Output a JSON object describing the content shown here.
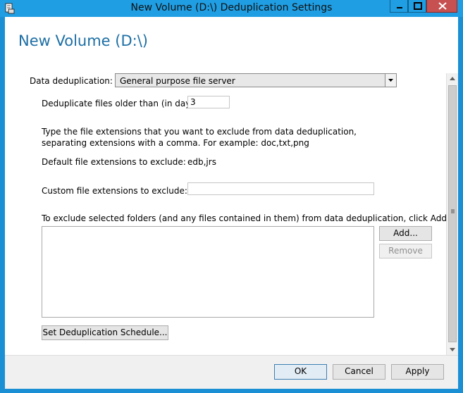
{
  "window": {
    "title": "New Volume (D:\\) Deduplication Settings",
    "icon": "volume-settings-icon",
    "controls": [
      "minimize-icon",
      "maximize-icon",
      "close-icon"
    ]
  },
  "page": {
    "heading": "New Volume (D:\\)"
  },
  "dedup": {
    "mode_label": "Data deduplication:",
    "mode_value": "General purpose file server",
    "age_label": "Deduplicate files older than (in days):",
    "age_value": "3",
    "instructions": "Type the file extensions that you want to exclude from data deduplication, separating extensions with a comma. For example: doc,txt,png",
    "default_ext_label": "Default file extensions to exclude:",
    "default_ext_value": "edb,jrs",
    "custom_ext_label": "Custom file extensions to exclude:",
    "custom_ext_value": "",
    "folders_instruction": "To exclude selected folders (and any files contained in them) from data deduplication, click Add.",
    "add_label": "Add...",
    "remove_label": "Remove",
    "schedule_label": "Set Deduplication Schedule..."
  },
  "footer": {
    "ok_label": "OK",
    "cancel_label": "Cancel",
    "apply_label": "Apply"
  },
  "colors": {
    "titlebar": "#1f9ee3",
    "heading": "#1d6fa5",
    "close": "#c75050"
  }
}
